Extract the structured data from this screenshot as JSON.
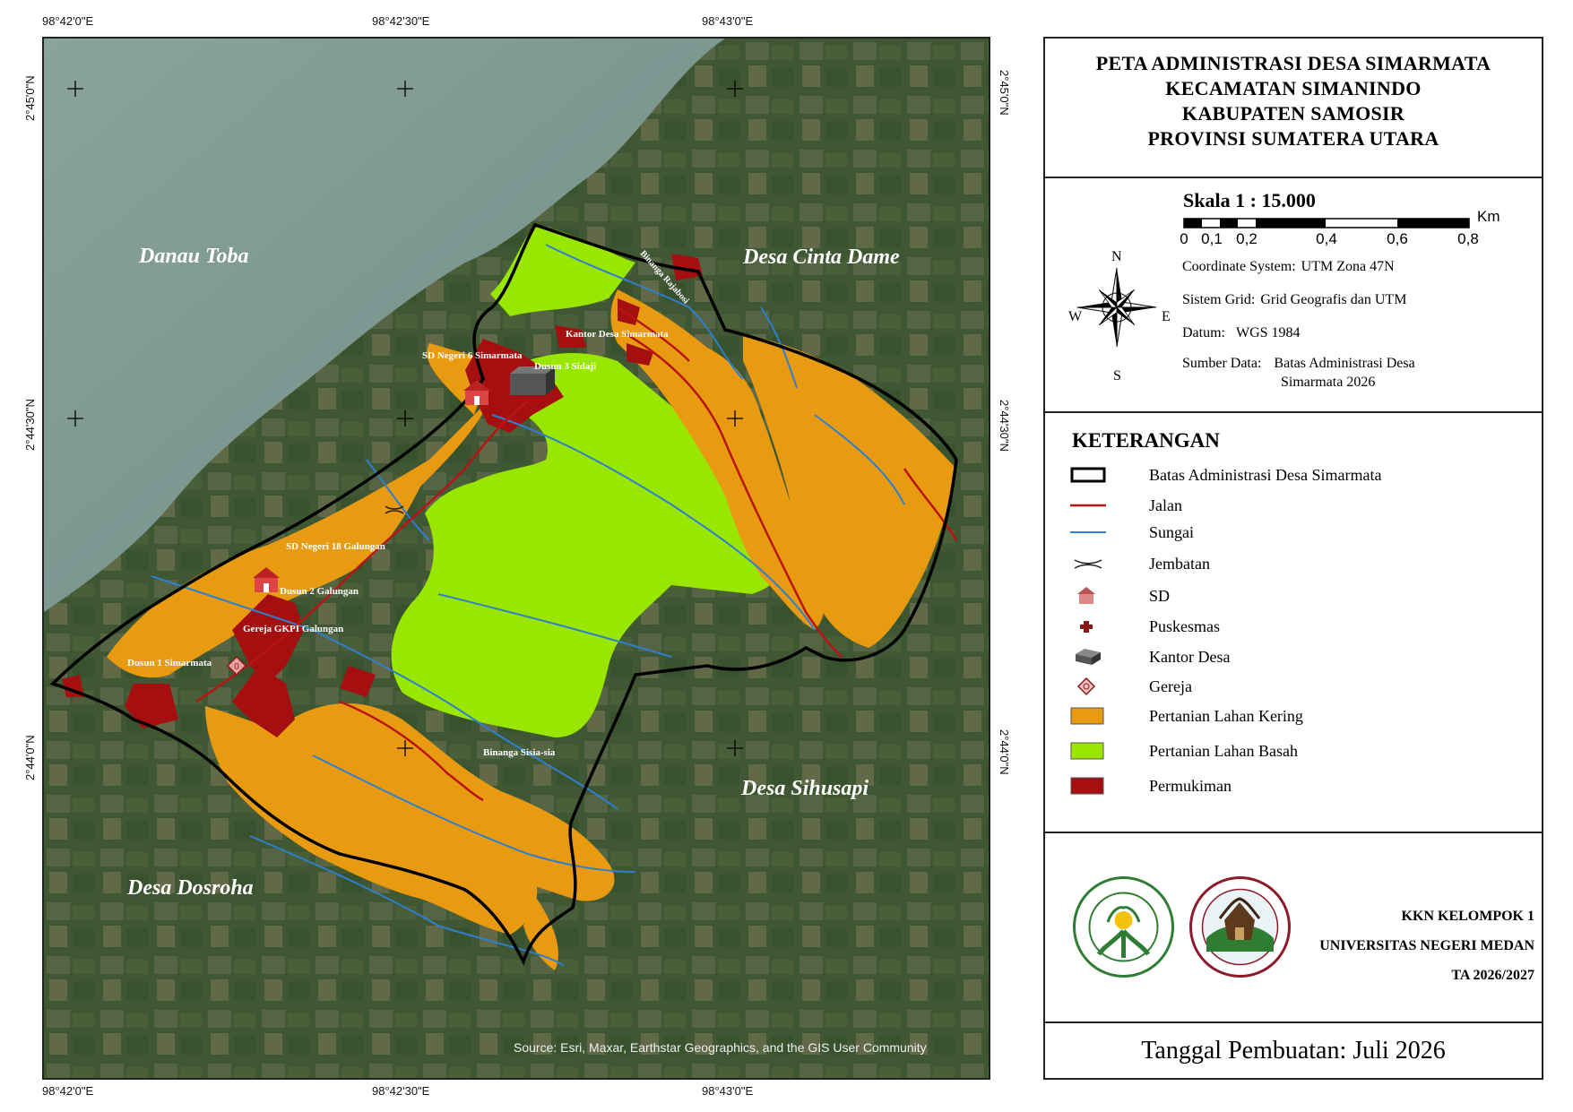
{
  "map": {
    "top_coords": [
      "98°42'0\"E",
      "98°42'30\"E",
      "98°43'0\"E"
    ],
    "bottom_coords": [
      "98°42'0\"E",
      "98°42'30\"E",
      "98°43'0\"E"
    ],
    "left_coords": [
      "2°45'0\"N",
      "2°44'30\"N",
      "2°44'0\"N"
    ],
    "right_coords": [
      "2°45'0\"N",
      "2°44'30\"N",
      "2°44'0\"N"
    ],
    "region_labels": {
      "danau_toba": "Danau Toba",
      "cinta_dame": "Desa Cinta Dame",
      "sihusapi": "Desa Sihusapi",
      "dosroha": "Desa Dosroha"
    },
    "feature_labels": {
      "sd6": "SD Negeri 6 Simarmata",
      "dusun3": "Dusun 3 Sidaji",
      "kantor": "Kantor Desa Simarmata",
      "sd18": "SD Negeri 18 Galungan",
      "dusun2": "Dusun 2 Galungan",
      "gereja": "Gereja GKPI Galungan",
      "dusun1": "Dusun 1 Simarmata",
      "rajabosi": "Binanga Rajabosi",
      "sisiasia": "Binanga Sisia-sia"
    },
    "source": "Source: Esri, Maxar, Earthstar Geographics, and the GIS User Community",
    "colors": {
      "lahan_kering": "#e89a10",
      "lahan_basah": "#99e600",
      "permukiman": "#a50f0f",
      "jalan": "#b81414",
      "sungai": "#2f7fd0",
      "lake": "#7f9a92",
      "land": "#3c5230"
    }
  },
  "title": {
    "lines": [
      "PETA ADMINISTRASI DESA SIMARMATA",
      "KECAMATAN SIMANINDO",
      "KABUPATEN SAMOSIR",
      "PROVINSI SUMATERA UTARA"
    ]
  },
  "scale": {
    "title": "Skala 1 : 15.000",
    "labels": [
      "0",
      "0,1",
      "0,2",
      "0,4",
      "0,6",
      "0,8"
    ],
    "unit": "Km"
  },
  "compass": {
    "n": "N",
    "s": "S",
    "e": "E",
    "w": "W"
  },
  "info": {
    "coordinate_system_label": "Coordinate System:",
    "coordinate_system_value": "UTM Zona 47N",
    "grid_label": "Sistem Grid:",
    "grid_value": "Grid Geografis dan UTM",
    "datum_label": "Datum:",
    "datum_value": "WGS 1984",
    "source_label": "Sumber Data:",
    "source_value_1": "Batas Administrasi Desa",
    "source_value_2": "Simarmata 2026"
  },
  "legend": {
    "title": "KETERANGAN",
    "items": [
      {
        "label": "Batas Administrasi Desa Simarmata",
        "icon": "boundary-icon"
      },
      {
        "label": "Jalan",
        "icon": "road-line-icon"
      },
      {
        "label": "Sungai",
        "icon": "river-line-icon"
      },
      {
        "label": "Jembatan",
        "icon": "bridge-icon"
      },
      {
        "label": "SD",
        "icon": "school-icon"
      },
      {
        "label": "Puskesmas",
        "icon": "health-cross-icon"
      },
      {
        "label": "Kantor Desa",
        "icon": "office-building-icon"
      },
      {
        "label": "Gereja",
        "icon": "church-icon"
      },
      {
        "label": "Pertanian Lahan Kering",
        "icon": "dry-farm-swatch"
      },
      {
        "label": "Pertanian Lahan Basah",
        "icon": "wet-farm-swatch"
      },
      {
        "label": "Permukiman",
        "icon": "settlement-swatch"
      }
    ]
  },
  "org": {
    "line1": "KKN KELOMPOK 1",
    "line2": "UNIVERSITAS NEGERI MEDAN",
    "line3": "TA 2026/2027",
    "logo1_text_top": "UNIVERSITAS NEGERI MEDAN",
    "logo1_text_bottom": "UNIMED",
    "logo2_text_top": "KKN UNIMED 2026",
    "logo2_text_bottom": "DESA SIMARMATA"
  },
  "date": "Tanggal Pembuatan: Juli 2026"
}
